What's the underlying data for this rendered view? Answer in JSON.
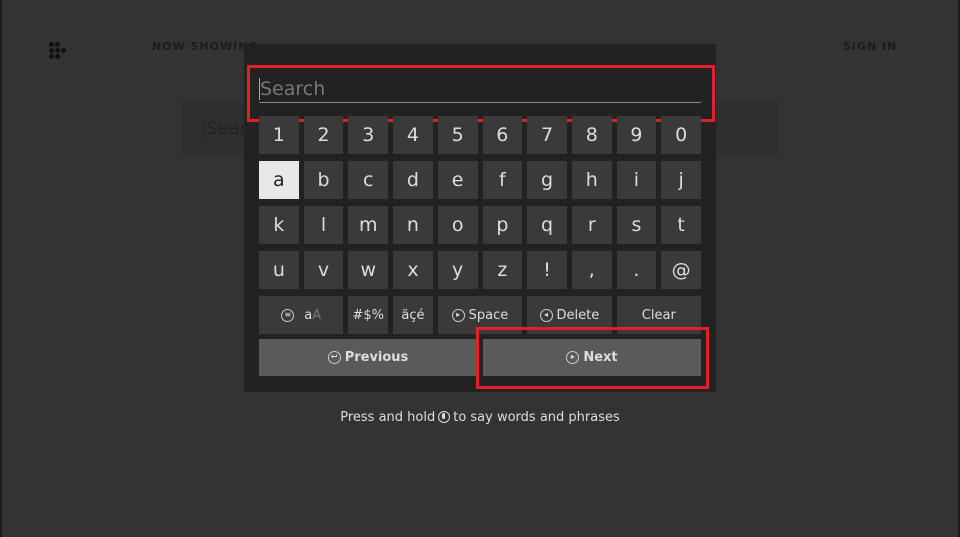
{
  "header": {
    "nav": [
      "NOW SHOWING"
    ],
    "sign_in": "SIGN IN"
  },
  "background_search": {
    "placeholder": "Search"
  },
  "keyboard": {
    "search_placeholder": "Search",
    "rows": [
      [
        "1",
        "2",
        "3",
        "4",
        "5",
        "6",
        "7",
        "8",
        "9",
        "0"
      ],
      [
        "a",
        "b",
        "c",
        "d",
        "e",
        "f",
        "g",
        "h",
        "i",
        "j"
      ],
      [
        "k",
        "l",
        "m",
        "n",
        "o",
        "p",
        "q",
        "r",
        "s",
        "t"
      ],
      [
        "u",
        "v",
        "w",
        "x",
        "y",
        "z",
        "!",
        ",",
        ".",
        "@"
      ]
    ],
    "selected_key": "a",
    "func_keys": {
      "case": "a",
      "case_alt": "A",
      "symbols": "#$%",
      "accents": "äçé",
      "space": "Space",
      "delete": "Delete",
      "clear": "Clear"
    },
    "previous": "Previous",
    "next": "Next"
  },
  "hint": {
    "before": "Press and hold",
    "after": "to say words and phrases"
  },
  "colors": {
    "highlight": "#e0202a",
    "panel": "#222222",
    "key": "#3a3a3a",
    "background": "#333333"
  }
}
